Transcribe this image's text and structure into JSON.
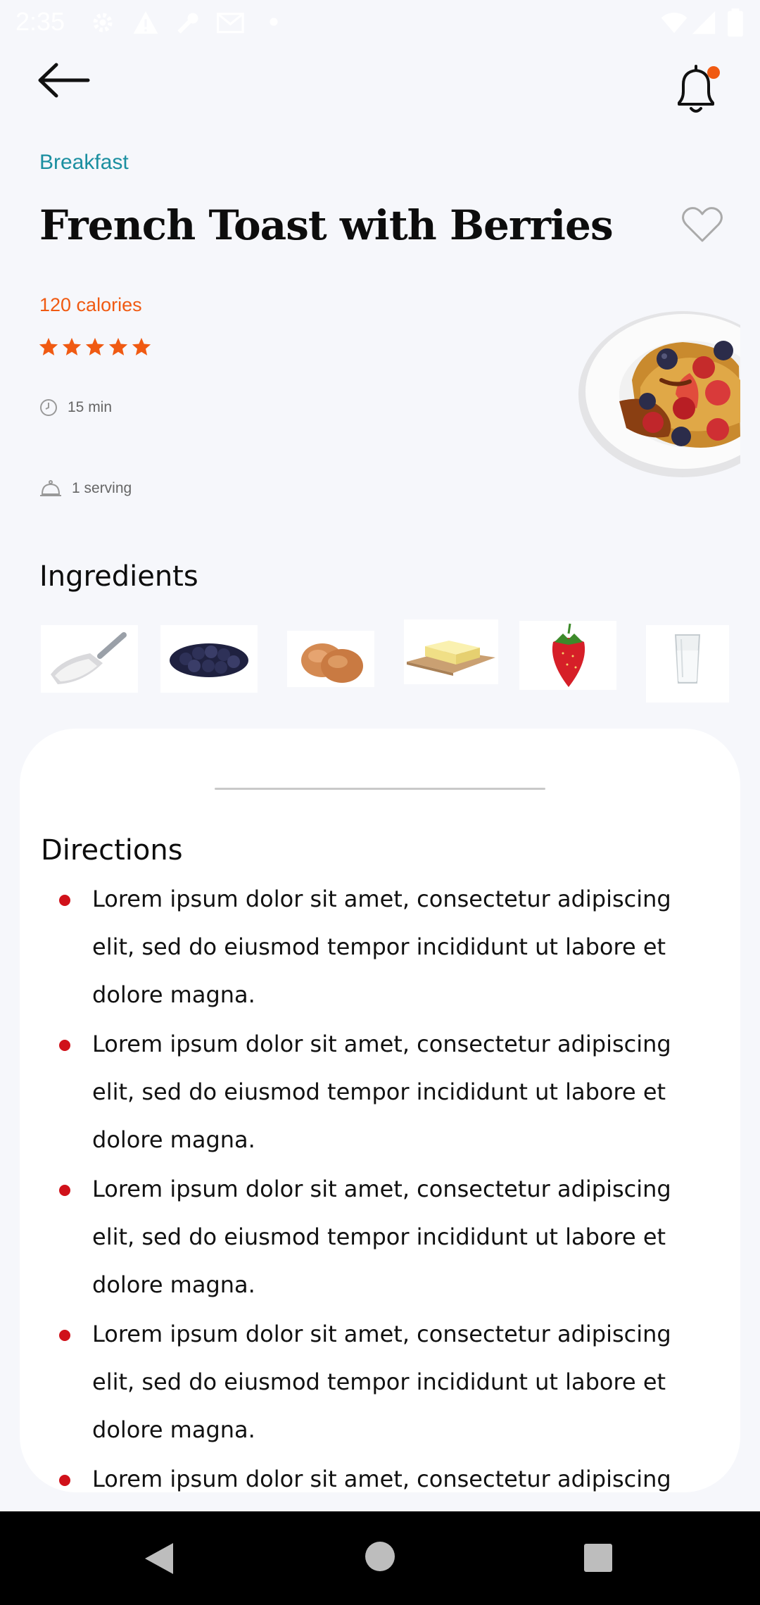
{
  "status_bar": {
    "time": "2:35",
    "icons": [
      "settings-icon",
      "warning-icon",
      "wrench-icon",
      "mail-icon",
      "dot-icon",
      "wifi-icon",
      "signal-icon",
      "battery-icon"
    ]
  },
  "top_bar": {
    "back_icon": "arrow-left-icon",
    "notification_icon": "bell-icon",
    "notification_badge_color": "#f05a12"
  },
  "recipe": {
    "category": "Breakfast",
    "title": "French Toast with Berries",
    "favorite_icon": "heart-outline-icon",
    "calories": "120 calories",
    "rating": 5,
    "time": "15 min",
    "servings": "1 serving",
    "image": "french-toast-plate-image"
  },
  "ingredients": {
    "title": "Ingredients",
    "items": [
      {
        "name": "flour-scoop-image"
      },
      {
        "name": "blueberries-image"
      },
      {
        "name": "eggs-image"
      },
      {
        "name": "butter-image"
      },
      {
        "name": "strawberry-image"
      },
      {
        "name": "glass-of-milk-image"
      }
    ]
  },
  "directions": {
    "title": "Directions",
    "steps": [
      "Lorem ipsum dolor sit amet, consectetur adipiscing elit, sed do eiusmod tempor incididunt ut labore et dolore magna.",
      "Lorem ipsum dolor sit amet, consectetur adipiscing elit, sed do eiusmod tempor incididunt ut labore et dolore magna.",
      "Lorem ipsum dolor sit amet, consectetur adipiscing elit, sed do eiusmod tempor incididunt ut labore et dolore magna.",
      "Lorem ipsum dolor sit amet, consectetur adipiscing elit, sed do eiusmod tempor incididunt ut labore et dolore magna.",
      "Lorem ipsum dolor sit amet, consectetur adipiscing"
    ]
  },
  "nav_bar": {
    "buttons": [
      "back-triangle-icon",
      "home-circle-icon",
      "recents-square-icon"
    ]
  },
  "colors": {
    "accent_orange": "#f05a12",
    "category_teal": "#1b8fa0",
    "bullet_red": "#d0111a",
    "background": "#f6f7fb"
  }
}
